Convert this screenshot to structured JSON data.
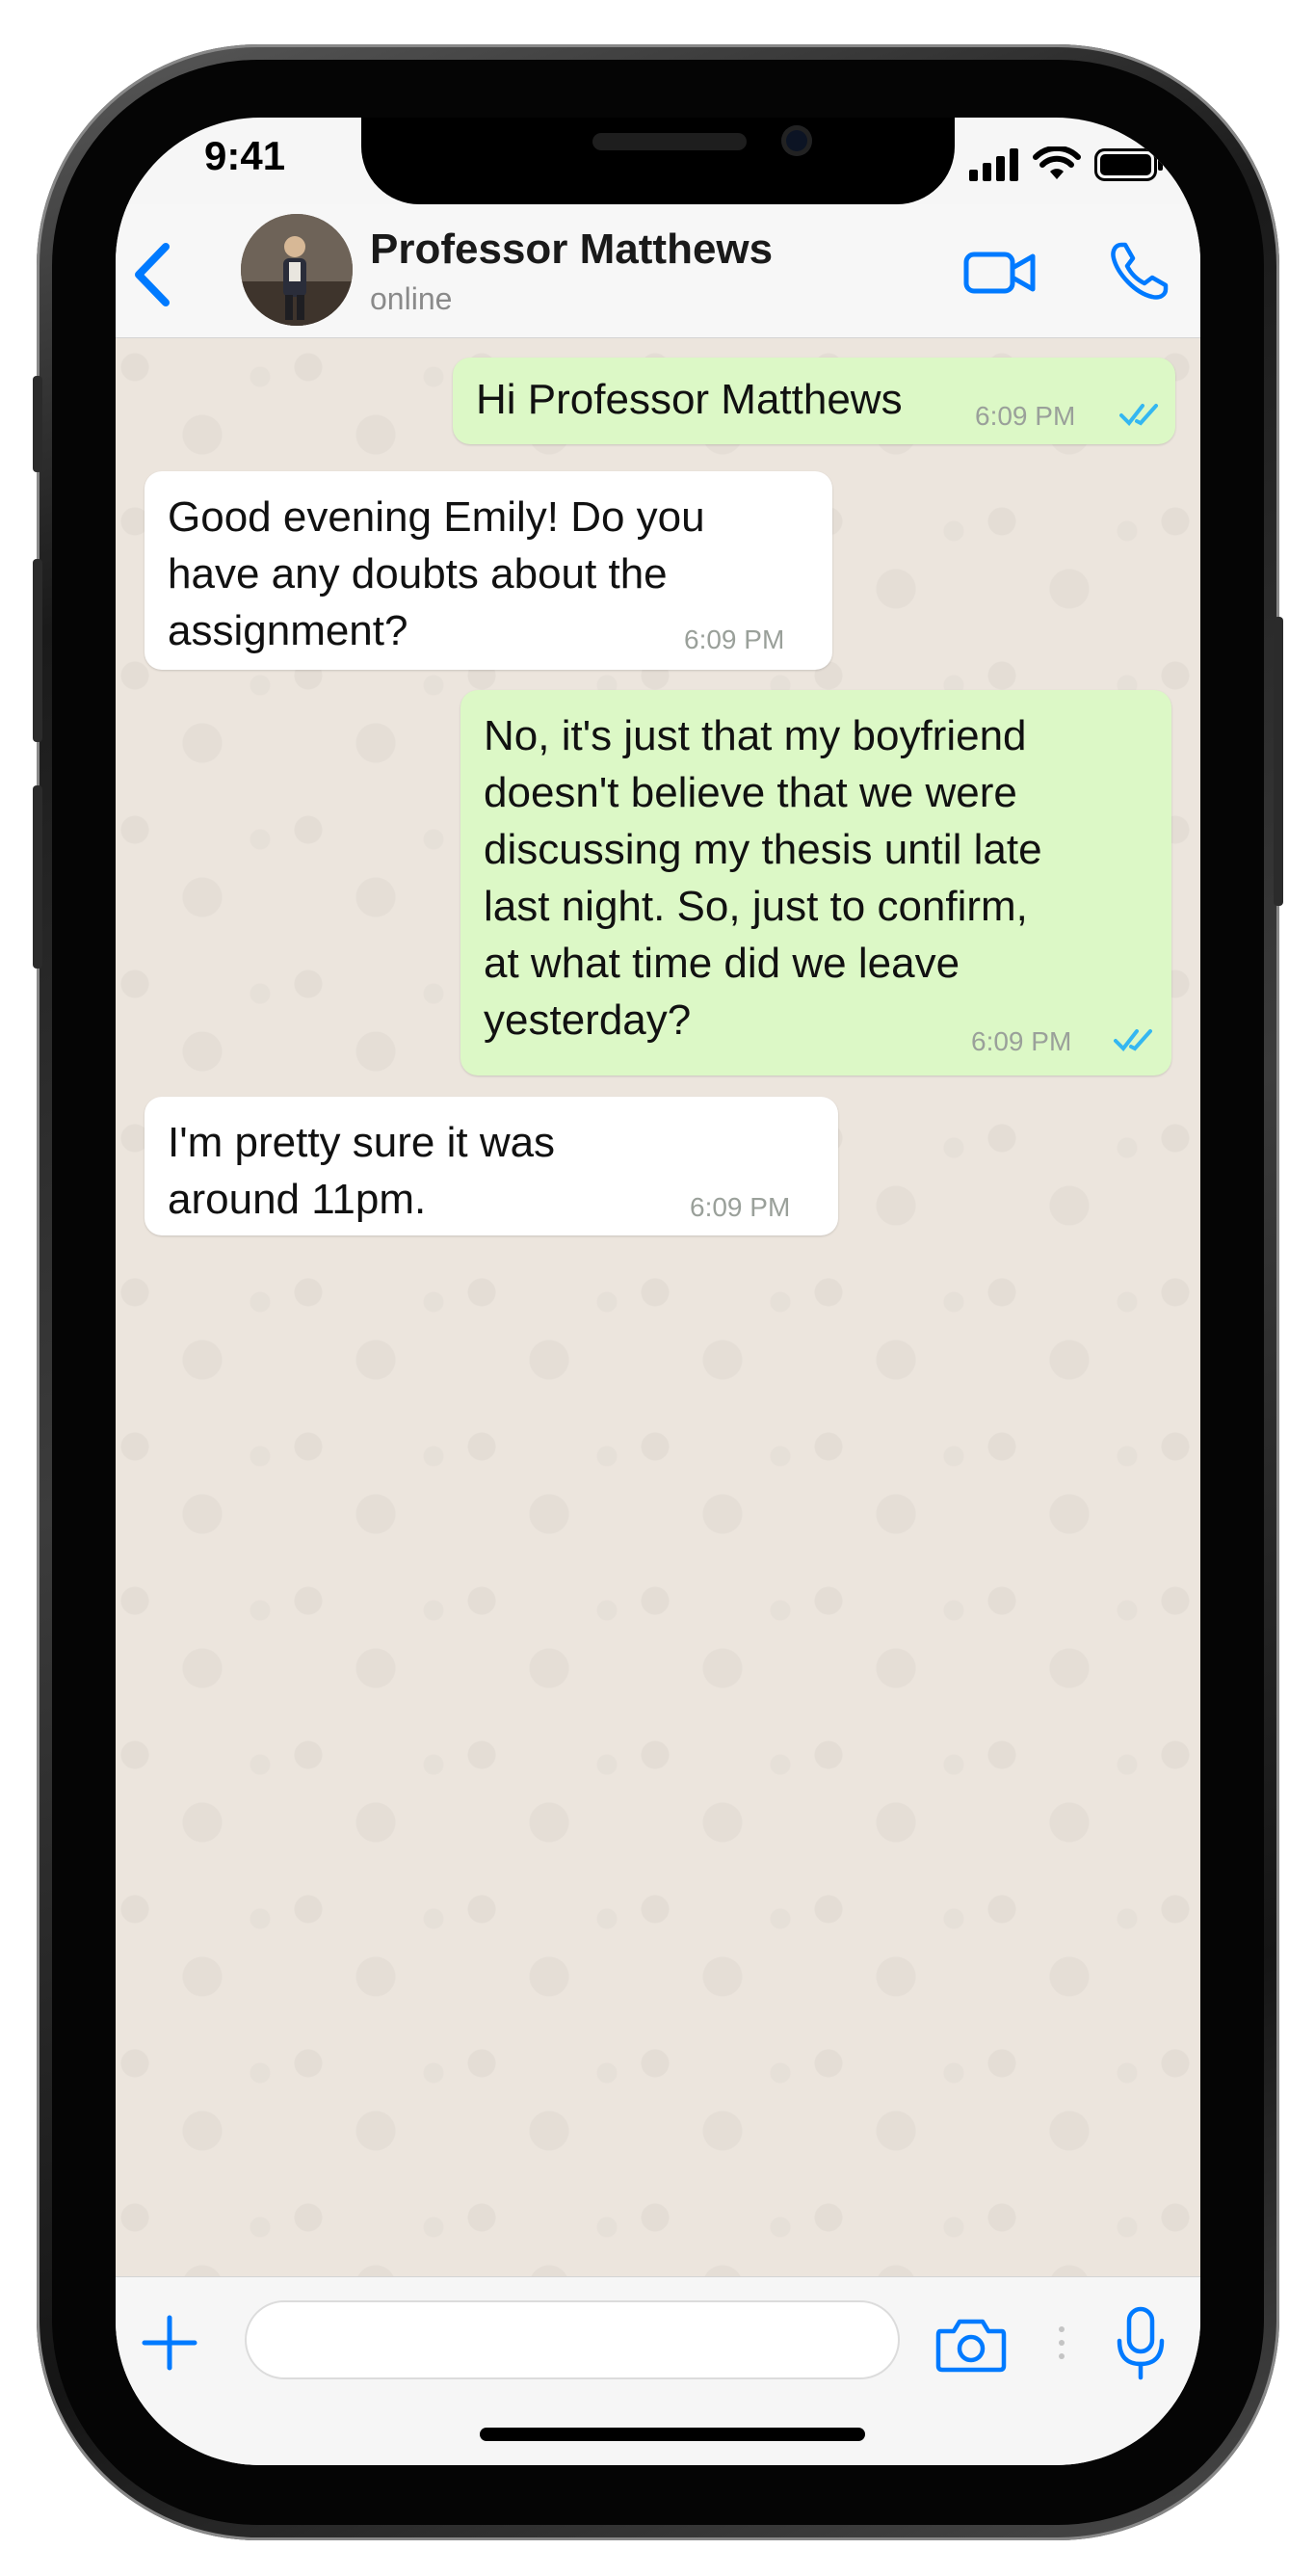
{
  "status_bar": {
    "time": "9:41"
  },
  "header": {
    "contact_name": "Professor Matthews",
    "contact_status": "online"
  },
  "messages": [
    {
      "direction": "out",
      "text": "Hi Professor Matthews",
      "time": "6:09 PM",
      "read": true
    },
    {
      "direction": "in",
      "text_lines": [
        "Good evening Emily! Do you",
        "have any doubts about the",
        "assignment?"
      ],
      "time": "6:09 PM"
    },
    {
      "direction": "out",
      "text_lines": [
        "No, it's just that my boyfriend",
        "doesn't believe that we were",
        "discussing my thesis until late",
        "last night. So, just to confirm,",
        "at what time did we leave",
        "yesterday?"
      ],
      "time": "6:09 PM",
      "read": true
    },
    {
      "direction": "in",
      "text_lines": [
        "I'm pretty sure it was",
        "around 11pm."
      ],
      "time": "6:09 PM"
    }
  ],
  "input": {
    "value": "",
    "placeholder": ""
  },
  "colors": {
    "accent": "#007aff",
    "outgoing_bubble": "#dcf8c6",
    "incoming_bubble": "#ffffff",
    "chat_background": "#ece5dd",
    "read_tick": "#34b7f1"
  },
  "icons": [
    "chevron-left-icon",
    "video-camera-icon",
    "phone-icon",
    "plus-icon",
    "camera-icon",
    "microphone-icon",
    "double-check-icon"
  ]
}
